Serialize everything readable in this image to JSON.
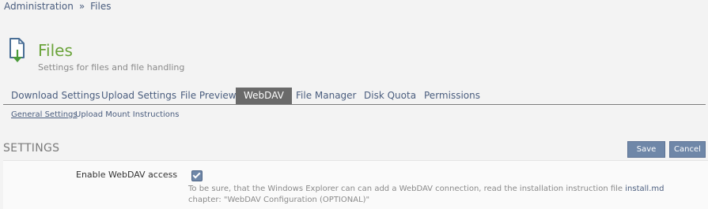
{
  "breadcrumb": {
    "items": [
      "Administration",
      "Files"
    ],
    "separator": "»"
  },
  "header": {
    "icon": "file-download-icon",
    "title": "Files",
    "subtitle": "Settings for files and file handling"
  },
  "tabs": [
    {
      "label": "Download Settings",
      "active": false
    },
    {
      "label": "Upload Settings",
      "active": false
    },
    {
      "label": "File Preview",
      "active": false
    },
    {
      "label": "WebDAV",
      "active": true
    },
    {
      "label": "File Manager",
      "active": false
    },
    {
      "label": "Disk Quota",
      "active": false
    },
    {
      "label": "Permissions",
      "active": false
    }
  ],
  "subtabs": [
    {
      "label": "General Settings",
      "active": true
    },
    {
      "label": "Upload Mount Instructions",
      "active": false
    }
  ],
  "section": {
    "title": "SETTINGS",
    "save_label": "Save",
    "cancel_label": "Cancel"
  },
  "setting": {
    "label": "Enable WebDAV access",
    "checked": true,
    "hint_pre": "To be sure, that the Windows Explorer can can add a WebDAV connection, read the installation instruction file ",
    "hint_link": "install.md",
    "hint_post": " chapter: \"WebDAV Configuration (OPTIONAL)\""
  },
  "colors": {
    "title_green": "#6aa33a",
    "link_blue": "#4a5d7e",
    "button_blue": "#6f87a8",
    "active_tab": "#6a6a6a"
  }
}
